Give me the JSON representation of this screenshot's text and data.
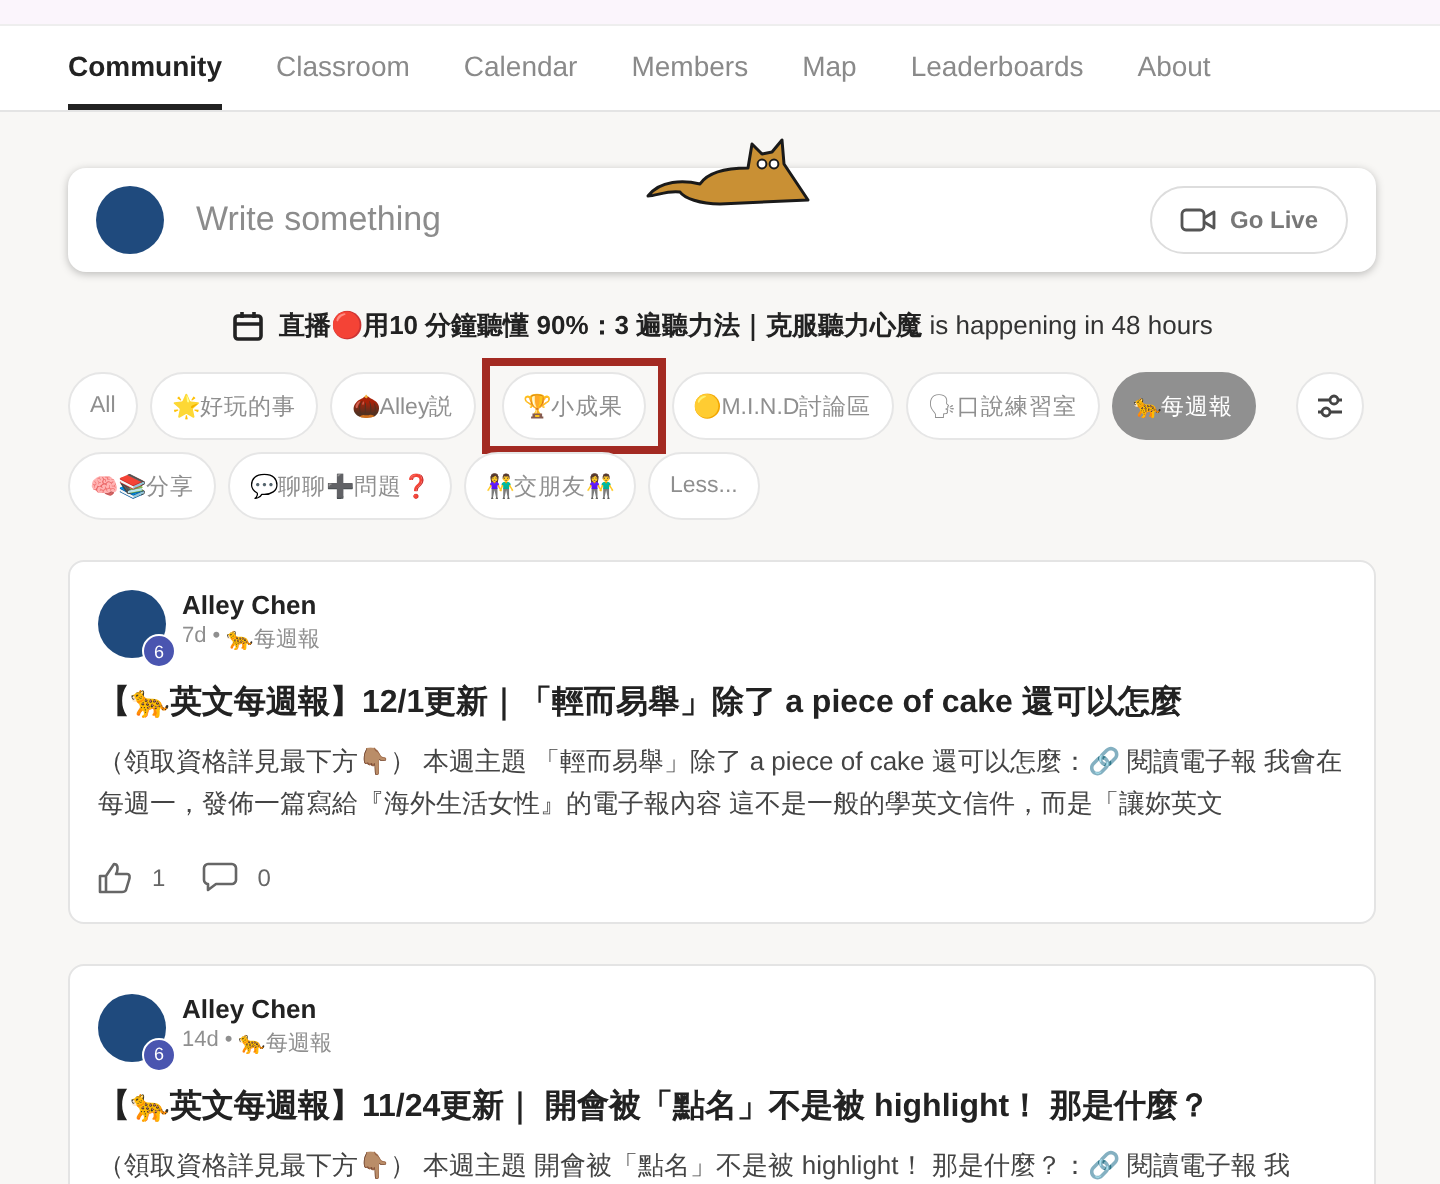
{
  "nav": {
    "tabs": [
      {
        "label": "Community",
        "selected": true
      },
      {
        "label": "Classroom",
        "selected": false
      },
      {
        "label": "Calendar",
        "selected": false
      },
      {
        "label": "Members",
        "selected": false
      },
      {
        "label": "Map",
        "selected": false
      },
      {
        "label": "Leaderboards",
        "selected": false
      },
      {
        "label": "About",
        "selected": false
      }
    ]
  },
  "composer": {
    "placeholder": "Write something",
    "go_live": "Go Live"
  },
  "event": {
    "text": "**直播🔴用10 分鐘聽懂 90%：3 遍聽力法｜克服聽力心魔** is happening in 48 hours"
  },
  "filters": [
    {
      "label": "All",
      "selected": false,
      "highlighted": false
    },
    {
      "label": "🌟好玩的事",
      "selected": false,
      "highlighted": false
    },
    {
      "label": "🌰Alley説",
      "selected": false,
      "highlighted": false
    },
    {
      "label": "🏆小成果",
      "selected": false,
      "highlighted": true
    },
    {
      "label": "🟡M.I.N.D討論區",
      "selected": false,
      "highlighted": false
    },
    {
      "label": "🗣口說練習室",
      "selected": false,
      "highlighted": false
    },
    {
      "label": "🐆每週報",
      "selected": true,
      "highlighted": false
    },
    {
      "label": "🧠📚分享",
      "selected": false,
      "highlighted": false
    },
    {
      "label": "💬聊聊➕問題❓",
      "selected": false,
      "highlighted": false
    },
    {
      "label": "👫交朋友👫",
      "selected": false,
      "highlighted": false
    },
    {
      "label": "Less...",
      "selected": false,
      "highlighted": false
    }
  ],
  "posts": [
    {
      "author": "Alley Chen",
      "level": "6",
      "age": "7d",
      "separator": "•",
      "category": "🐆每週報",
      "title": "【🐆英文每週報】12/1更新｜「輕而易舉」除了 a piece of cake 還可以怎麼",
      "body": "（領取資格詳見最下方👇🏽） 本週主題 「輕而易舉」除了 a piece of cake 還可以怎麼：🔗 閱讀電子報 我會在每週一，發佈一篇寫給『海外生活女性』的電子報內容 這不是一般的學英文信件，而是「讓妳英文",
      "likes": "1",
      "comments": "0"
    },
    {
      "author": "Alley Chen",
      "level": "6",
      "age": "14d",
      "separator": "•",
      "category": "🐆每週報",
      "title": "【🐆英文每週報】11/24更新｜ 開會被「點名」不是被 highlight！ 那是什麼？",
      "body": "（領取資格詳見最下方👇🏽） 本週主題 開會被「點名」不是被 highlight！ 那是什麼？：🔗 閱讀電子報 我"
    }
  ]
}
